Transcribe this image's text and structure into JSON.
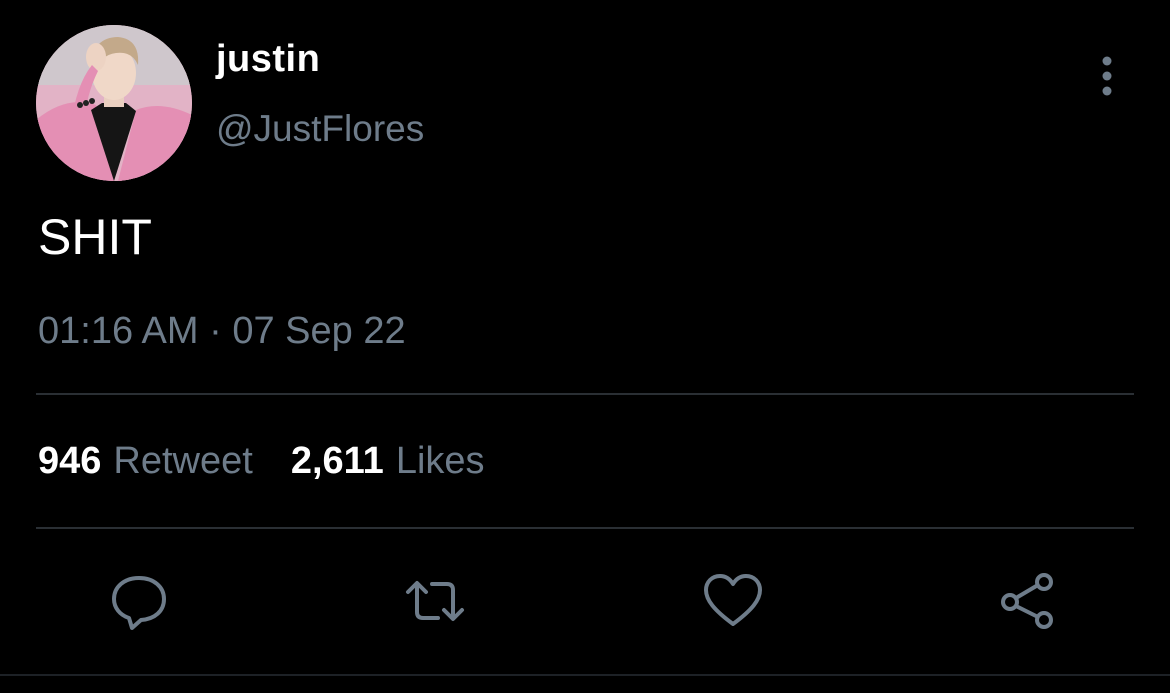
{
  "tweet": {
    "display_name": "justin",
    "handle": "@JustFlores",
    "text": "SHIT",
    "timestamp": "01:16 AM · 07 Sep 22",
    "stats": {
      "retweets_count": "946",
      "retweets_label": "Retweet",
      "likes_count": "2,611",
      "likes_label": "Likes"
    }
  },
  "icons": {
    "more": "vertical-dots-icon",
    "reply": "speech-bubble-icon",
    "retweet": "retweet-arrows-icon",
    "like": "heart-icon",
    "share": "share-nodes-icon"
  },
  "colors": {
    "background": "#000000",
    "primary_text": "#ffffff",
    "secondary_text": "#6e7c8a",
    "divider": "#2a2f34",
    "icon": "#6e7c8a"
  }
}
